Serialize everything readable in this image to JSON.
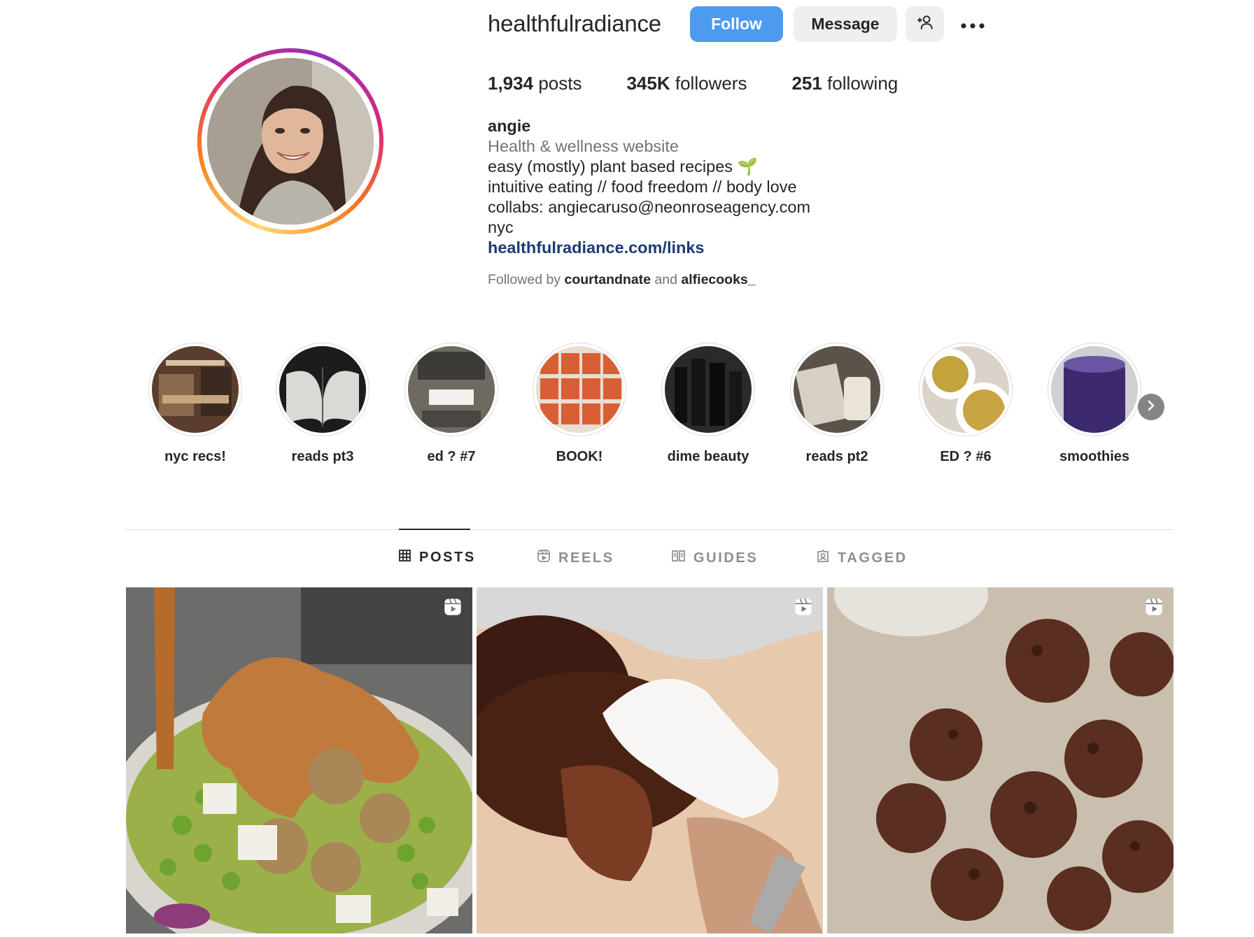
{
  "profile": {
    "username": "healthfulradiance",
    "follow_label": "Follow",
    "message_label": "Message",
    "stats": {
      "posts_count": "1,934",
      "posts_label": "posts",
      "followers_count": "345K",
      "followers_label": "followers",
      "following_count": "251",
      "following_label": "following"
    },
    "bio": {
      "name": "angie",
      "category": "Health & wellness website",
      "line1": "easy (mostly) plant based recipes 🌱",
      "line2": "intuitive eating // food freedom // body love",
      "line3": "collabs: angiecaruso@neonroseagency.com",
      "line4": "nyc",
      "link": "healthfulradiance.com/links"
    },
    "followed_by": {
      "prefix": "Followed by",
      "user1": "courtandnate",
      "joiner": "and",
      "user2": "alfiecooks_"
    }
  },
  "highlights": [
    {
      "label": "nyc recs!"
    },
    {
      "label": "reads pt3"
    },
    {
      "label": "ed ? #7"
    },
    {
      "label": "BOOK!"
    },
    {
      "label": "dime beauty"
    },
    {
      "label": "reads pt2"
    },
    {
      "label": "ED ? #6"
    },
    {
      "label": "smoothies"
    }
  ],
  "tabs": [
    {
      "label": "POSTS",
      "icon": "grid-icon",
      "active": true
    },
    {
      "label": "REELS",
      "icon": "reels-icon",
      "active": false
    },
    {
      "label": "GUIDES",
      "icon": "guides-icon",
      "active": false
    },
    {
      "label": "TAGGED",
      "icon": "tagged-icon",
      "active": false
    }
  ],
  "posts": [
    {
      "type": "reel",
      "icon": "reels-icon"
    },
    {
      "type": "reel",
      "icon": "reels-icon"
    },
    {
      "type": "reel",
      "icon": "reels-icon"
    }
  ],
  "colors": {
    "follow_button": "#4c9bf0",
    "link": "#1d3a72",
    "secondary_text": "#737373"
  }
}
